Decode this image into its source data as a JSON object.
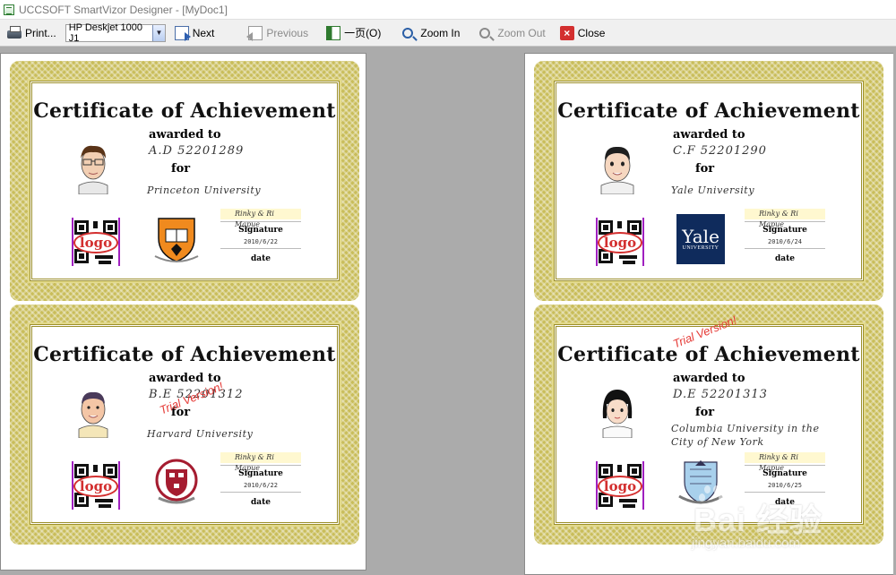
{
  "window": {
    "title": "UCCSOFT SmartVizor Designer - [MyDoc1]"
  },
  "toolbar": {
    "print_label": "Print...",
    "printer_value": "HP Deskjet 1000 J1",
    "next_label": "Next",
    "previous_label": "Previous",
    "onepage_label": "一页(O)",
    "zoom_in_label": "Zoom In",
    "zoom_out_label": "Zoom Out",
    "close_label": "Close"
  },
  "certificate_common": {
    "title": "Certificate of Achievement",
    "awarded_to": "awarded to",
    "for": "for",
    "signature_label": "Signature",
    "date_label": "date",
    "logo_text": "logo",
    "signature_scribble": "Rinky & Ri Mapue"
  },
  "certificates": [
    {
      "name": "A.D  52201289",
      "university": "Princeton University",
      "sig_date": "2010/6/22"
    },
    {
      "name": "B.E  52201312",
      "university": "Harvard University",
      "sig_date": "2010/6/22"
    },
    {
      "name": "C.F  52201290",
      "university": "Yale University",
      "sig_date": "2010/6/24",
      "emblem_text_1": "Yale",
      "emblem_text_2": "UNIVERSITY"
    },
    {
      "name": "D.E  52201313",
      "university": "Columbia University in the City of New York",
      "sig_date": "2010/6/25"
    }
  ],
  "trial_text": "Trial Version!",
  "watermark": {
    "brand": "Bai  经验",
    "sub": "jingyan.baidu.com"
  },
  "colors": {
    "frame": "#c9bd5a",
    "trial": "#e53935",
    "yale_blue": "#0f2b5c",
    "harvard_red": "#a51c30"
  }
}
